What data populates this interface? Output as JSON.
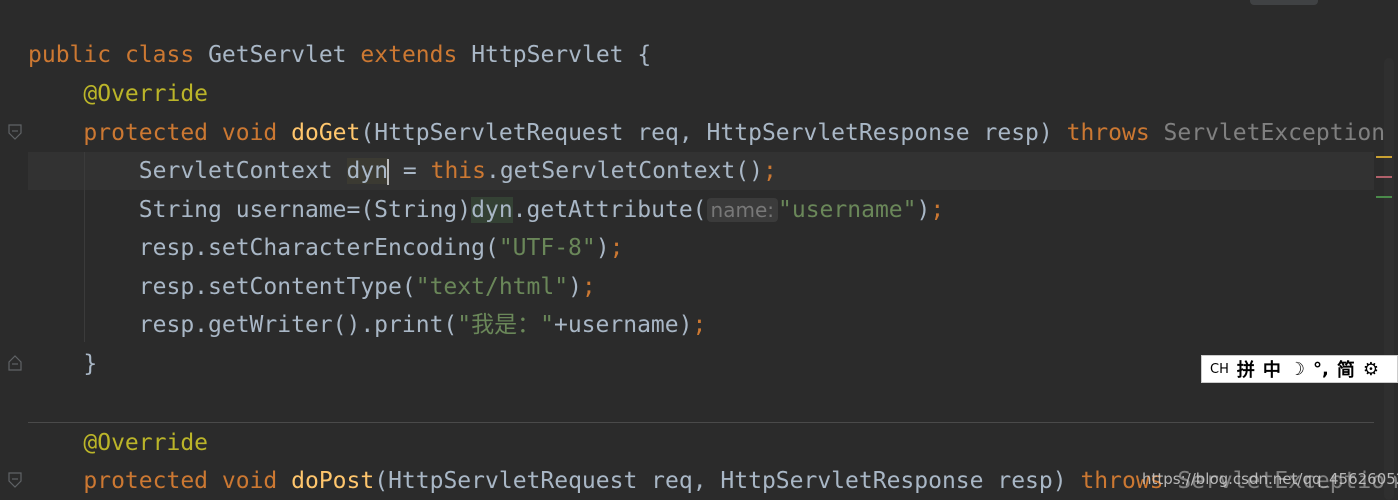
{
  "editor": {
    "lines": [
      {
        "id": "l1"
      },
      {
        "id": "l2"
      }
    ],
    "code": {
      "l1": {
        "kw1": "public",
        "kw2": "class",
        "name": "GetServlet",
        "kw3": "extends",
        "parent": "HttpServlet",
        "brace": "{"
      },
      "l2": {
        "annotation": "@Override"
      },
      "l3": {
        "kw1": "protected",
        "kw2": "void",
        "method": "doGet",
        "params": "(HttpServletRequest req, HttpServletResponse resp) ",
        "throws": "throws",
        "exc": "ServletException"
      },
      "l4": {
        "type": "ServletContext ",
        "var": "dyn",
        "rest1": " = ",
        "this": "this",
        "rest2": ".getServletContext()",
        "semi": ";"
      },
      "l5": {
        "pre": "String username=(String)",
        "var": "dyn",
        "mid": ".getAttribute(",
        "hint": "name:",
        "str": "\"username\"",
        "close": ")",
        "semi": ";"
      },
      "l6": {
        "pre": "resp.setCharacterEncoding(",
        "str": "\"UTF-8\"",
        "close": ")",
        "semi": ";"
      },
      "l7": {
        "pre": "resp.setContentType(",
        "str": "\"text/html\"",
        "close": ")",
        "semi": ";"
      },
      "l8": {
        "pre": "resp.getWriter().print(",
        "str": "\"我是：\"",
        "rest": "+username)",
        "semi": ";"
      },
      "l9": {
        "brace": "}"
      },
      "l10": {
        "annotation": "@Override"
      },
      "l11": {
        "kw1": "protected",
        "kw2": "void",
        "method": "doPost",
        "params": "(HttpServletRequest req, HttpServletResponse resp) ",
        "throws": "throws",
        "exc": "ServletException"
      }
    },
    "colors": {
      "background": "#2b2b2b",
      "keyword": "#cc7832",
      "annotation": "#bbb529",
      "method": "#ffc66d",
      "string": "#6a8759",
      "text": "#a9b7c6"
    }
  },
  "ime_bar": {
    "lang": "CH",
    "pinyin": "拼",
    "mode": "中",
    "moon": "☽",
    "punct": "°,",
    "simplified": "简",
    "settings": "⚙"
  },
  "watermark": "https://blog.csdn.net/qq_45626052"
}
